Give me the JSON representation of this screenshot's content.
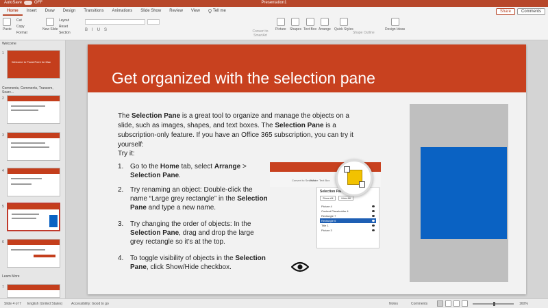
{
  "window": {
    "title": "Presentation1",
    "autosave_label": "AutoSave",
    "autosave_state": "OFF"
  },
  "tabs": [
    {
      "label": "Home",
      "active": true
    },
    {
      "label": "Insert"
    },
    {
      "label": "Draw"
    },
    {
      "label": "Design"
    },
    {
      "label": "Transitions"
    },
    {
      "label": "Animations"
    },
    {
      "label": "Slide Show"
    },
    {
      "label": "Review"
    },
    {
      "label": "View"
    },
    {
      "label": "Tell me"
    }
  ],
  "header_buttons": {
    "share": "Share",
    "comments": "Comments"
  },
  "ribbon": {
    "paste": "Paste",
    "cut": "Cut",
    "copy": "Copy",
    "format": "Format",
    "new_slide": "New Slide",
    "layout": "Layout",
    "reset": "Reset",
    "section": "Section",
    "convert_smartart": "Convert to SmartArt",
    "picture": "Picture",
    "shapes": "Shapes",
    "text_box": "Text Box",
    "arrange": "Arrange",
    "quick_styles": "Quick Styles",
    "shape_format": "Shape Outline",
    "design_ideas": "Design Ideas"
  },
  "thumbnails": {
    "section_welcome": "Welcome",
    "section_two": "Comments, Comments, Transem, Searc...",
    "section_learn": "Learn More",
    "thumb1_text": "Welcome to PowerPoint for Mac",
    "numbers": [
      "1",
      "2",
      "3",
      "4",
      "5",
      "6",
      "7"
    ]
  },
  "slide": {
    "title": "Get organized with the selection pane",
    "para_1a": "The ",
    "para_1b": "Selection Pane",
    "para_1c": " is a great tool to organize and manage the objects on a slide, such as images, shapes, and text boxes. The ",
    "para_1d": "Selection Pane",
    "para_1e": " is a subscription-only feature. If you have an Office 365 subscription, you can try it yourself:",
    "try_it": "Try it:",
    "steps": [
      {
        "num": "1.",
        "a": "Go to the ",
        "b": "Home",
        "c": " tab, select ",
        "d": "Arrange",
        "e": " > ",
        "f": "Selection Pane",
        "g": "."
      },
      {
        "num": "2.",
        "a": "Try renaming an object: Double-click the name “Large grey rectangle” in the ",
        "b": "Selection Pane",
        "c": " and type a new name."
      },
      {
        "num": "3.",
        "a": "Try changing the order of objects: In the ",
        "b": "Selection Pane",
        "c": ", drag and drop the large grey rectangle so it’s at the top."
      },
      {
        "num": "4.",
        "a": "To toggle visibility of objects in the ",
        "b": "Selection Pane",
        "c": ", click Show/Hide checkbox."
      }
    ]
  },
  "selection_pane_image": {
    "title": "Selection Pane",
    "show_all": "Show All",
    "hide_all": "Hide All",
    "items": [
      "Picture 4",
      "Content Placeholder 4",
      "Rectangle 7",
      "Rectangle 6",
      "Title 1",
      "Picture 3"
    ],
    "highlighted_index": 3,
    "ribbon_labels": [
      "Convert to SmartArt",
      "Picture",
      "Text Box",
      "Arrange"
    ]
  },
  "status": {
    "slide_of": "Slide 4 of 7",
    "language": "English (United States)",
    "accessibility": "Accessibility: Good to go",
    "notes": "Notes",
    "comments": "Comments",
    "zoom": "160%"
  },
  "colors": {
    "accent": "#c8411f",
    "blue_shape": "#0a62c3",
    "grey_shape": "#bfbfbf"
  }
}
